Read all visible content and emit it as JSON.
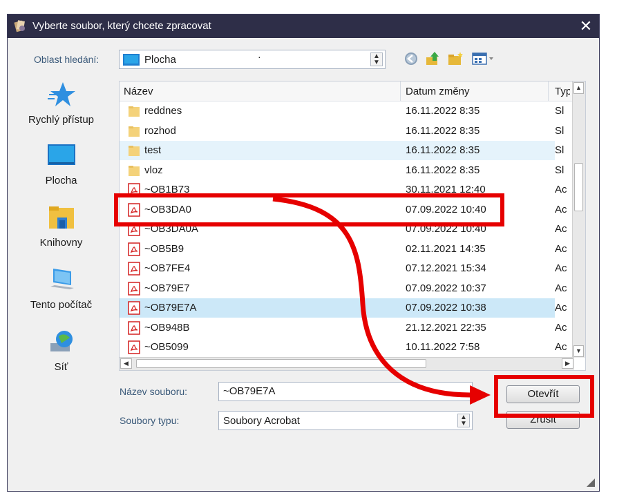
{
  "dialog": {
    "title": "Vyberte soubor, který chcete zpracovat",
    "close_symbol": "✕"
  },
  "lookin": {
    "label": "Oblast hledání:",
    "value": "Plocha",
    "dot": "·"
  },
  "places": [
    {
      "label": "Rychlý přístup",
      "icon": "star-icon"
    },
    {
      "label": "Plocha",
      "icon": "desktop-icon"
    },
    {
      "label": "Knihovny",
      "icon": "libraries-icon"
    },
    {
      "label": "Tento počítač",
      "icon": "computer-icon"
    },
    {
      "label": "Síť",
      "icon": "network-icon"
    }
  ],
  "columns": {
    "name": "Název",
    "date": "Datum změny",
    "type": "Typ"
  },
  "files": [
    {
      "name": "reddnes",
      "date": "16.11.2022 8:35",
      "type": "Sl",
      "kind": "folder"
    },
    {
      "name": "rozhod",
      "date": "16.11.2022 8:35",
      "type": "Sl",
      "kind": "folder"
    },
    {
      "name": "test",
      "date": "16.11.2022 8:35",
      "type": "Sl",
      "kind": "folder"
    },
    {
      "name": "vloz",
      "date": "16.11.2022 8:35",
      "type": "Sl",
      "kind": "folder"
    },
    {
      "name": "~OB1B73",
      "date": "30.11.2021 12:40",
      "type": "Ac",
      "kind": "pdf"
    },
    {
      "name": "~OB3DA0",
      "date": "07.09.2022 10:40",
      "type": "Ac",
      "kind": "pdf"
    },
    {
      "name": "~OB3DA0A",
      "date": "07.09.2022 10:40",
      "type": "Ac",
      "kind": "pdf"
    },
    {
      "name": "~OB5B9",
      "date": "02.11.2021 14:35",
      "type": "Ac",
      "kind": "pdf"
    },
    {
      "name": "~OB7FE4",
      "date": "07.12.2021 15:34",
      "type": "Ac",
      "kind": "pdf"
    },
    {
      "name": "~OB79E7",
      "date": "07.09.2022 10:37",
      "type": "Ac",
      "kind": "pdf"
    },
    {
      "name": "~OB79E7A",
      "date": "07.09.2022 10:38",
      "type": "Ac",
      "kind": "pdf"
    },
    {
      "name": "~OB948B",
      "date": "21.12.2021 22:35",
      "type": "Ac",
      "kind": "pdf"
    },
    {
      "name": "~OB5099",
      "date": "10.11.2022 7:58",
      "type": "Ac",
      "kind": "pdf"
    }
  ],
  "form": {
    "filename_label": "Název souboru:",
    "filename_value": "~OB79E7A",
    "filetype_label": "Soubory typu:",
    "filetype_value": "Soubory Acrobat"
  },
  "buttons": {
    "open": "Otevřít",
    "cancel": "Zrušit"
  },
  "colors": {
    "titlebar": "#2e2e48",
    "annotation": "#e60000",
    "selected_row": "#cce8f8"
  }
}
